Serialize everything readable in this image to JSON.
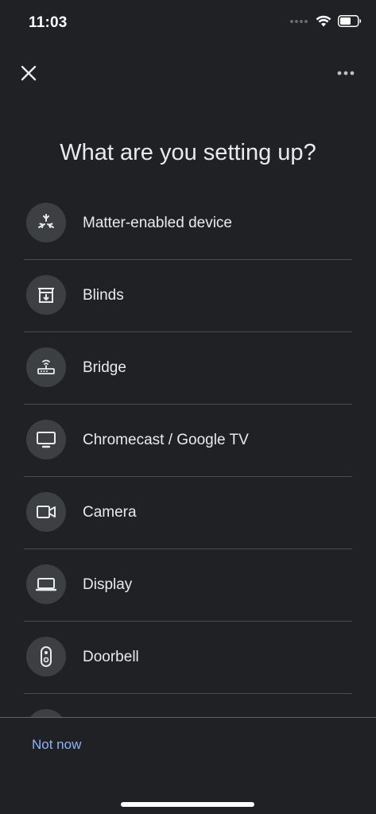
{
  "status_bar": {
    "time": "11:03"
  },
  "header": {
    "close_icon": "close-icon",
    "more_icon": "more-horizontal-icon"
  },
  "page": {
    "title": "What are you setting up?"
  },
  "devices": [
    {
      "label": "Matter-enabled device",
      "icon": "matter-icon"
    },
    {
      "label": "Blinds",
      "icon": "blinds-icon"
    },
    {
      "label": "Bridge",
      "icon": "bridge-icon"
    },
    {
      "label": "Chromecast / Google TV",
      "icon": "tv-icon"
    },
    {
      "label": "Camera",
      "icon": "camera-icon"
    },
    {
      "label": "Display",
      "icon": "display-icon"
    },
    {
      "label": "Doorbell",
      "icon": "doorbell-icon"
    }
  ],
  "footer": {
    "not_now_label": "Not now"
  },
  "colors": {
    "background": "#202124",
    "icon_circle": "#3c4043",
    "link": "#8ab4f8",
    "text": "#e8eaed"
  }
}
